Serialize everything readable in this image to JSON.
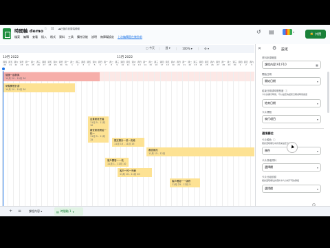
{
  "titlebar": {
    "doc_title": "時間軸 demo",
    "title_icons": "☆ ⊡ ☁",
    "save_status": "已儲存到雲端硬碟",
    "menu": [
      "檔案",
      "編輯",
      "查看",
      "插入",
      "格式",
      "資料",
      "工具",
      "擴充功能",
      "說明",
      "無障礙設定"
    ],
    "last_edit": "上次編輯是在幾秒前",
    "share_label": "共用"
  },
  "toolbar": {
    "today": "今天",
    "scale": "週",
    "scale_caret": "▾",
    "zoom": "100%",
    "zoom_caret": "▾",
    "settings": "⚙",
    "settings_caret": "▾"
  },
  "timeline": {
    "months": [
      "10月 2022",
      "11月 2022"
    ],
    "days": [
      {
        "w": "週四",
        "d": "20"
      },
      {
        "w": "週五",
        "d": "21"
      },
      {
        "w": "週六",
        "d": "22"
      },
      {
        "w": "週日",
        "d": "23"
      },
      {
        "w": "週一",
        "d": "24"
      },
      {
        "w": "週二",
        "d": "25"
      },
      {
        "w": "週三",
        "d": "26"
      },
      {
        "w": "週四",
        "d": "27"
      },
      {
        "w": "週五",
        "d": "28"
      },
      {
        "w": "週六",
        "d": "29"
      },
      {
        "w": "週日",
        "d": "30"
      },
      {
        "w": "週一",
        "d": "31"
      },
      {
        "w": "週二",
        "d": "1"
      },
      {
        "w": "週三",
        "d": "2"
      },
      {
        "w": "週四",
        "d": "3"
      },
      {
        "w": "週五",
        "d": "4"
      },
      {
        "w": "週六",
        "d": "5"
      },
      {
        "w": "週日",
        "d": "6"
      },
      {
        "w": "週一",
        "d": "7"
      },
      {
        "w": "週二",
        "d": "8"
      },
      {
        "w": "週三",
        "d": "9"
      },
      {
        "w": "週四",
        "d": "10"
      },
      {
        "w": "週五",
        "d": "11"
      },
      {
        "w": "週六",
        "d": "12"
      },
      {
        "w": "週日",
        "d": "13"
      },
      {
        "w": "週一",
        "d": "14"
      },
      {
        "w": "週二",
        "d": "15"
      },
      {
        "w": "週三",
        "d": "16"
      },
      {
        "w": "週四",
        "d": "17"
      },
      {
        "w": "週五",
        "d": "18"
      },
      {
        "w": "週六",
        "d": "19"
      },
      {
        "w": "週日",
        "d": "20"
      },
      {
        "w": "週一",
        "d": "21"
      },
      {
        "w": "週二",
        "d": "22"
      },
      {
        "w": "週三",
        "d": "23"
      },
      {
        "w": "週四",
        "d": "24"
      },
      {
        "w": "週五",
        "d": "25"
      },
      {
        "w": "週六",
        "d": "26"
      },
      {
        "w": "週日",
        "d": "27"
      },
      {
        "w": "週一",
        "d": "28"
      },
      {
        "w": "週二",
        "d": "29"
      },
      {
        "w": "週三",
        "d": "30"
      },
      {
        "w": "週四",
        "d": "1"
      },
      {
        "w": "週五",
        "d": "2"
      },
      {
        "w": "週六",
        "d": "3"
      }
    ],
    "cards": [
      {
        "name": "陪團一起參與",
        "date": "10月 20 - 10月 30",
        "color": "pink"
      },
      {
        "name": "研擬開發計劃",
        "date": "10月 20 - 10月 30",
        "color": "yellow"
      },
      {
        "name": "召集委員會議",
        "date": "11月 5 - 11月 10",
        "color": "yellow"
      },
      {
        "name": "審查委員開始一校一",
        "date": "11月 5 - 11月 15",
        "color": "yellow"
      },
      {
        "name": "擬定審計一校一完稿",
        "date": "11月 10 - 11月 15",
        "color": "yellow"
      },
      {
        "name": "審查委員",
        "date": "11月 15 - 12月",
        "color": "yellow"
      },
      {
        "name": "客戶開發一一校",
        "date": "11月 1 - 11月 10",
        "color": "yellow"
      },
      {
        "name": "客戶一校一完稿",
        "date": "11月 10 - 11月 20",
        "color": "yellow"
      },
      {
        "name": "客戶確認一一版修",
        "date": "11月 25 - 12月 5",
        "color": "yellow"
      }
    ]
  },
  "panel": {
    "close": "✕",
    "title": "設定",
    "data_label": "資料來源範圍",
    "data_value": "課程內容!A1:F10",
    "start_label": "開始日期",
    "start_value": "開始日期",
    "end_label": "結束日期或時間長度",
    "end_hint": "卡片的顯示時間，可以設定為結束日期或時間長度",
    "end_value": "結束日期",
    "title_label": "卡片標題",
    "title_value": "執行項目",
    "optional_section": "選填欄位",
    "color_label": "卡片顏色",
    "color_hint": "根據選取欄位中的值來設定卡片顏色",
    "color_value": "顏色",
    "details_label": "卡片詳細資料",
    "details_value": "選擇欄",
    "group_label": "卡片分組依據",
    "group_hint": "根據選取欄位的值將卡片分成不同的群組",
    "group_value": "選擇欄",
    "caret": "▾",
    "gear": "⚙",
    "info": "ⓘ",
    "feedback": "💬"
  },
  "sheets": {
    "add": "+",
    "all": "≡",
    "tabs": [
      "課程內容",
      "時間軸 1"
    ],
    "active_caret": "▾"
  }
}
